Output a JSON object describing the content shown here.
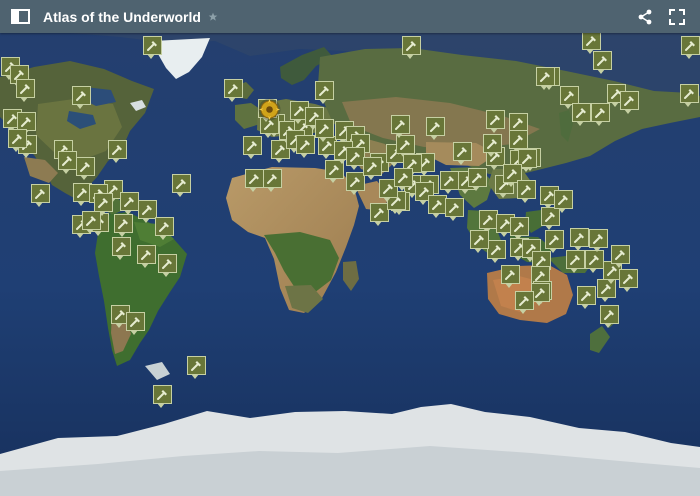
{
  "app": {
    "title": "Atlas of the Underworld"
  },
  "icons": {
    "panel_toggle": "panel-toggle-icon",
    "favorite": "star-icon",
    "share": "share-icon",
    "fullscreen": "fullscreen-icon",
    "marker_symbol": "hammer-icon",
    "highlight_marker": "sun-badge-icon"
  },
  "colors": {
    "header": "#4f6370",
    "ocean": "#1f3f72",
    "marker_fill": "#687638",
    "marker_border": "#c6d0a3",
    "highlight": "#d0a31a"
  },
  "markers": {
    "count": 129
  }
}
